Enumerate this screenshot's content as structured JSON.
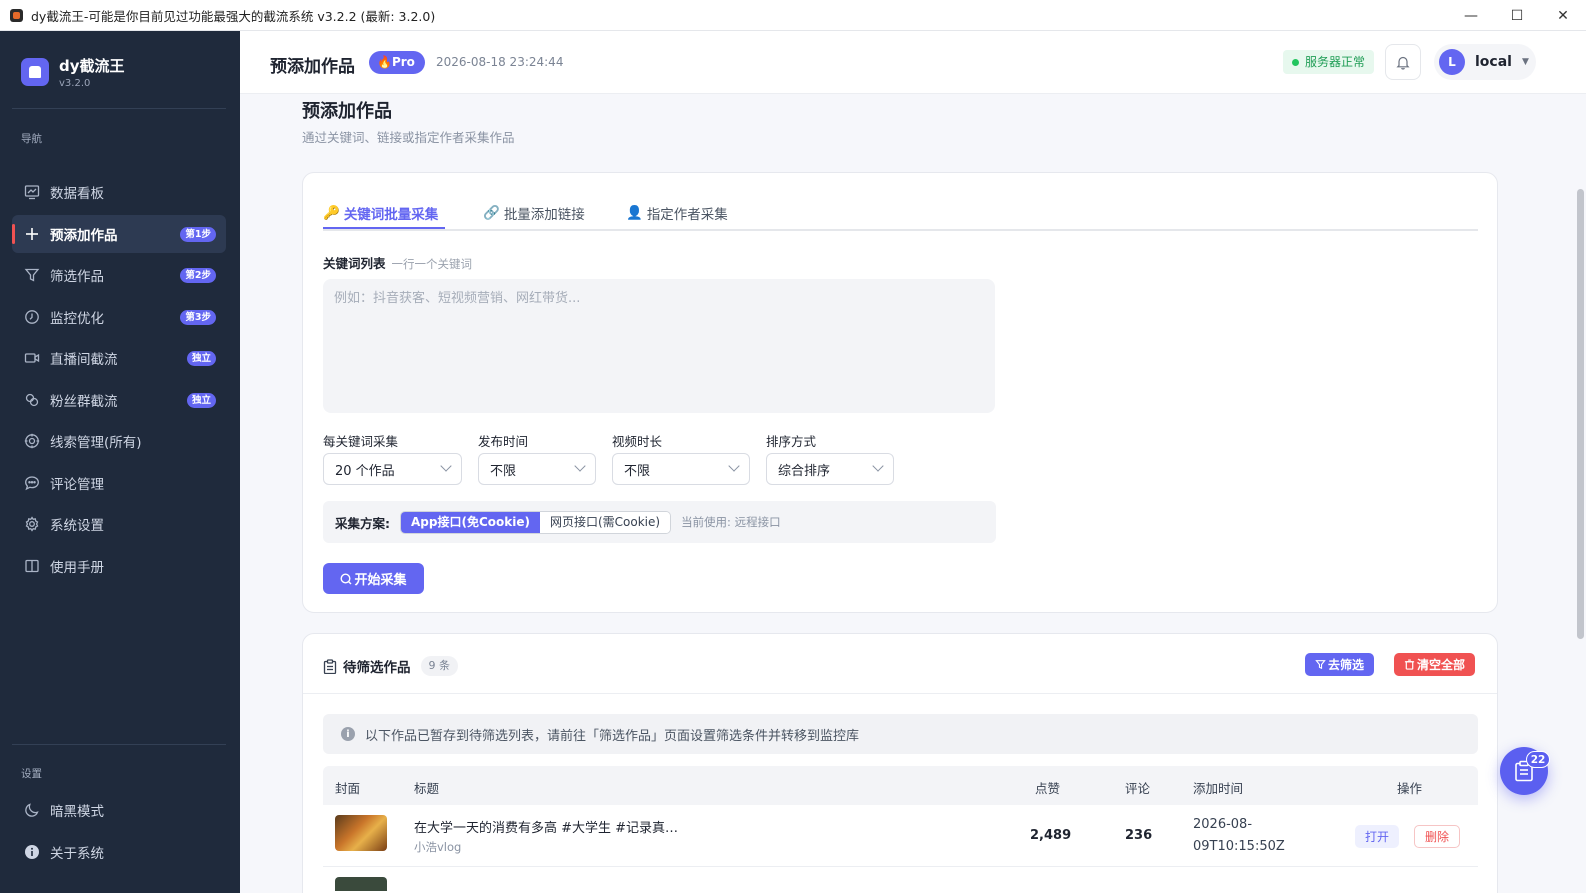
{
  "window": {
    "title": "dy截流王-可能是你目前见过功能最强大的截流系统 v3.2.2 (最新: 3.2.0)"
  },
  "brand": {
    "name": "dy截流王",
    "version": "v3.2.0"
  },
  "sidebar": {
    "nav_section": "导航",
    "items": [
      {
        "label": "数据看板",
        "icon": "chart-board-icon",
        "badge": ""
      },
      {
        "label": "预添加作品",
        "icon": "plus-icon",
        "badge": "第1步",
        "active": true
      },
      {
        "label": "筛选作品",
        "icon": "filter-icon",
        "badge": "第2步"
      },
      {
        "label": "监控优化",
        "icon": "monitor-icon",
        "badge": "第3步"
      },
      {
        "label": "直播间截流",
        "icon": "video-icon",
        "badge": "独立"
      },
      {
        "label": "粉丝群截流",
        "icon": "group-icon",
        "badge": "独立"
      },
      {
        "label": "线索管理(所有)",
        "icon": "target-icon",
        "badge": ""
      },
      {
        "label": "评论管理",
        "icon": "comment-icon",
        "badge": ""
      },
      {
        "label": "系统设置",
        "icon": "gear-icon",
        "badge": ""
      },
      {
        "label": "使用手册",
        "icon": "book-icon",
        "badge": ""
      }
    ],
    "settings_section": "设置",
    "bottom_items": [
      {
        "label": "暗黑模式",
        "icon": "moon-icon"
      },
      {
        "label": "关于系统",
        "icon": "info-icon"
      }
    ]
  },
  "header": {
    "title": "预添加作品",
    "pro_badge": "Pro",
    "timestamp": "2026-08-18 23:24:44",
    "server_status": "服务器正常",
    "user_initial": "L",
    "user_name": "local"
  },
  "page": {
    "title": "预添加作品",
    "subtitle": "通过关键词、链接或指定作者采集作品",
    "tabs": [
      "关键词批量采集",
      "批量添加链接",
      "指定作者采集"
    ],
    "keyword_label": "关键词列表",
    "keyword_hint": "一行一个关键词",
    "keyword_placeholder": "例如：抖音获客、短视频营销、网红带货...",
    "filters": [
      {
        "label": "每关键词采集",
        "value": "20 个作品"
      },
      {
        "label": "发布时间",
        "value": "不限"
      },
      {
        "label": "视频时长",
        "value": "不限"
      },
      {
        "label": "排序方式",
        "value": "综合排序"
      }
    ],
    "scheme_label": "采集方案:",
    "scheme_options": [
      "App接口(免Cookie)",
      "网页接口(需Cookie)"
    ],
    "scheme_current": "当前使用: 远程接口",
    "start_button": "开始采集"
  },
  "pending": {
    "title": "待筛选作品",
    "count": "9 条",
    "filter_button": "去筛选",
    "clear_button": "清空全部",
    "info": "以下作品已暂存到待筛选列表，请前往「筛选作品」页面设置筛选条件并转移到监控库",
    "columns": [
      "封面",
      "标题",
      "点赞",
      "评论",
      "添加时间",
      "操作"
    ],
    "rows": [
      {
        "title": "在大学一天的消费有多高 #大学生 #记录真…",
        "author": "小浩vlog",
        "likes": "2,489",
        "comments": "236",
        "added_line1": "2026-08-",
        "added_line2": "09T10:15:50Z",
        "open": "打开",
        "delete": "删除"
      }
    ]
  },
  "fab": {
    "badge": "22"
  },
  "colors": {
    "accent": "#6366f1",
    "danger": "#f05252",
    "success": "#22c55e",
    "sidebar_bg": "#1f2a3c"
  }
}
